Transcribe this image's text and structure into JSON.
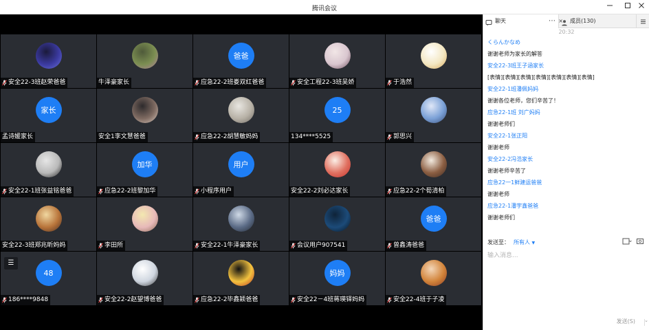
{
  "window": {
    "title": "腾讯会议"
  },
  "tiles": [
    {
      "name": "安全22-3班赵荣爸爸",
      "mic": true,
      "avatar": {
        "type": "img",
        "colors": [
          "#1b1a3a",
          "#3b3aa0",
          "#6a70d8"
        ]
      }
    },
    {
      "name": "牛泽豪家长",
      "mic": false,
      "avatar": {
        "type": "img",
        "colors": [
          "#4f5a3a",
          "#7c8f52",
          "#b57fa0"
        ]
      }
    },
    {
      "name": "应急22-2班娄双红爸爸",
      "mic": true,
      "avatar": {
        "type": "text",
        "text": "爸爸"
      }
    },
    {
      "name": "安全工程22-3班吴娇",
      "mic": true,
      "avatar": {
        "type": "img",
        "colors": [
          "#f1e6e6",
          "#d9c6cf",
          "#6b4b5a"
        ]
      }
    },
    {
      "name": "于浩然",
      "mic": true,
      "avatar": {
        "type": "img",
        "colors": [
          "#ffffff",
          "#f3e7c2",
          "#d8a95b"
        ]
      }
    },
    {
      "name": "孟诗媛家长",
      "mic": false,
      "avatar": {
        "type": "text",
        "text": "家长"
      }
    },
    {
      "name": "安全1李文慧爸爸",
      "mic": false,
      "avatar": {
        "type": "img",
        "colors": [
          "#2d2a2c",
          "#7f6b62",
          "#d9c8bd"
        ]
      }
    },
    {
      "name": "应急22-2胡慧敏妈妈",
      "mic": true,
      "avatar": {
        "type": "img",
        "colors": [
          "#e8e6e1",
          "#b7b1a6",
          "#6f6a63"
        ]
      }
    },
    {
      "name": "134****5525",
      "mic": false,
      "avatar": {
        "type": "text",
        "text": "25"
      }
    },
    {
      "name": "郭思兴",
      "mic": true,
      "avatar": {
        "type": "img",
        "colors": [
          "#dfe7f7",
          "#7aa0d6",
          "#3a4e78"
        ]
      }
    },
    {
      "name": "安全22-1班张益铭爸爸",
      "mic": true,
      "avatar": {
        "type": "img",
        "colors": [
          "#e6e6e6",
          "#b9b9b9",
          "#222222"
        ]
      }
    },
    {
      "name": "应急22-2班黎加华",
      "mic": true,
      "avatar": {
        "type": "text",
        "text": "加华"
      }
    },
    {
      "name": "小程序用户",
      "mic": true,
      "avatar": {
        "type": "text",
        "text": "用户"
      }
    },
    {
      "name": "安全22-2刘必达家长",
      "mic": false,
      "avatar": {
        "type": "img",
        "colors": [
          "#fbefe6",
          "#e07060",
          "#c4302b"
        ]
      }
    },
    {
      "name": "应急22-2个荀清柏",
      "mic": true,
      "avatar": {
        "type": "img",
        "colors": [
          "#f2eadf",
          "#8b5e42",
          "#3b2a23"
        ]
      }
    },
    {
      "name": "安全22-3班郑兆昕妈妈",
      "mic": false,
      "avatar": {
        "type": "img",
        "colors": [
          "#f0d7a0",
          "#b8743a",
          "#4a2e23"
        ]
      }
    },
    {
      "name": "李田所",
      "mic": true,
      "avatar": {
        "type": "img",
        "colors": [
          "#f3e8b0",
          "#e7b9b9",
          "#8d6a55"
        ]
      }
    },
    {
      "name": "安全22-1牛泽豪家长",
      "mic": true,
      "avatar": {
        "type": "img",
        "colors": [
          "#cfd9e6",
          "#5b6b86",
          "#222831"
        ]
      }
    },
    {
      "name": "会议用户907541",
      "mic": true,
      "avatar": {
        "type": "img",
        "colors": [
          "#0f2338",
          "#1c4b79",
          "#07131f"
        ]
      }
    },
    {
      "name": "曾鑫涛爸爸",
      "mic": true,
      "avatar": {
        "type": "text",
        "text": "爸爸"
      }
    },
    {
      "name": "186****9848",
      "mic": true,
      "avatar": {
        "type": "text",
        "text": "48"
      },
      "menu_icon": "list-icon"
    },
    {
      "name": "安全22-2赵望博爸爸",
      "mic": true,
      "avatar": {
        "type": "img",
        "colors": [
          "#ffffff",
          "#cfd6e0",
          "#3a3a3a"
        ]
      }
    },
    {
      "name": "应急22-2毕鑫颖爸爸",
      "mic": true,
      "avatar": {
        "type": "img",
        "colors": [
          "#111111",
          "#f3c23f",
          "#b83222"
        ]
      }
    },
    {
      "name": "安全22－4班蒋瑛铎妈妈",
      "mic": true,
      "avatar": {
        "type": "text",
        "text": "妈妈"
      }
    },
    {
      "name": "安全22-4班于子凌",
      "mic": true,
      "avatar": {
        "type": "img",
        "colors": [
          "#f3d6b8",
          "#d2843a",
          "#8a3a24"
        ]
      }
    }
  ],
  "chat": {
    "tab_chat": "聊天",
    "tab_members": "成员(130)",
    "time": "20:32",
    "messages": [
      {
        "kind": "sender",
        "text": "くらんかなめ"
      },
      {
        "kind": "body",
        "text": "谢谢老师为家长的解答"
      },
      {
        "kind": "sender",
        "text": "安全22-3班王子涵家长"
      },
      {
        "kind": "body",
        "text": "[表情][表情][表情][表情][表情][表情][表情]"
      },
      {
        "kind": "sender",
        "text": "安全22-1班潘佩妈妈"
      },
      {
        "kind": "body",
        "text": "谢谢各位老师，您们辛苦了！"
      },
      {
        "kind": "sender",
        "text": "应急22-1班 刘广妈妈"
      },
      {
        "kind": "body",
        "text": "谢谢老师们"
      },
      {
        "kind": "sender",
        "text": "安全22-1张正阳"
      },
      {
        "kind": "body",
        "text": "谢谢老师"
      },
      {
        "kind": "sender",
        "text": "安全22-2冯浩家长"
      },
      {
        "kind": "body",
        "text": "谢谢老师辛苦了"
      },
      {
        "kind": "sender",
        "text": "应急22一1鲜建运爸爸"
      },
      {
        "kind": "body",
        "text": "谢谢老师"
      },
      {
        "kind": "sender",
        "text": "应急22-1潘宇鑫爸爸"
      },
      {
        "kind": "body",
        "text": "谢谢老师们"
      }
    ],
    "send_to_label": "发送至：",
    "send_to_value": "所有人",
    "input_placeholder": "输入消息...",
    "send_label": "发送(S)"
  },
  "colors": {
    "accent": "#1e7ef5",
    "tile_bg": "#2a2d33"
  }
}
